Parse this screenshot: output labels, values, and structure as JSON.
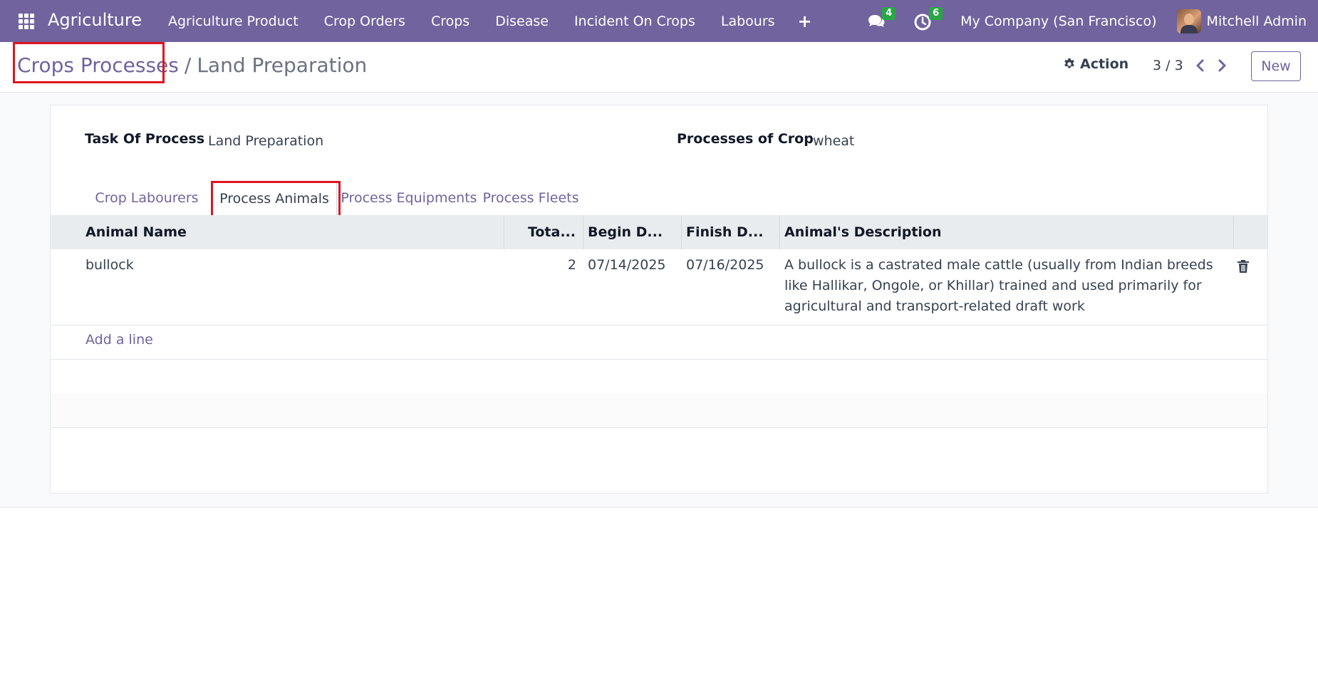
{
  "navbar": {
    "brand": "Agriculture",
    "menu": [
      "Agriculture Product",
      "Crop Orders",
      "Crops",
      "Disease",
      "Incident On Crops",
      "Labours"
    ],
    "plus": "+",
    "messages_badge": "4",
    "activities_badge": "6",
    "company": "My Company (San Francisco)",
    "user": "Mitchell Admin"
  },
  "breadcrumb": {
    "parent": "Crops Processes",
    "separator": "/",
    "current": "Land Preparation"
  },
  "control": {
    "action_label": "Action",
    "pager": "3 / 3",
    "new_label": "New"
  },
  "form": {
    "task_label": "Task Of Process",
    "task_value": "Land Preparation",
    "crop_label": "Processes of Crop",
    "crop_value": "wheat"
  },
  "tabs": [
    "Crop Labourers",
    "Process Animals",
    "Process Equipments",
    "Process Fleets"
  ],
  "active_tab": "Process Animals",
  "table": {
    "columns": [
      "Animal Name",
      "Tota...",
      "Begin D...",
      "Finish D...",
      "Animal's Description"
    ],
    "rows": [
      {
        "animal": "bullock",
        "total": "2",
        "begin": "07/14/2025",
        "finish": "07/16/2025",
        "description": "A bullock is a castrated male cattle (usually from Indian breeds like Hallikar, Ongole, or Khillar) trained and used primarily for agricultural and transport-related draft work"
      }
    ],
    "add_line": "Add a line"
  },
  "colors": {
    "brand": "#71639e",
    "badge": "#28a745",
    "highlight": "#e0141e"
  }
}
